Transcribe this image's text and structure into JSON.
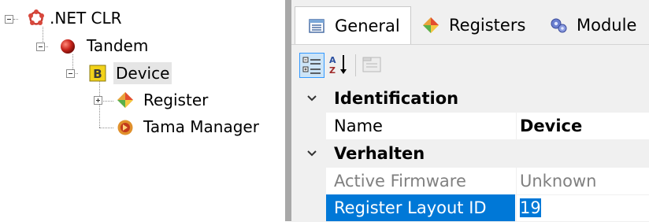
{
  "tree": {
    "nodes": [
      {
        "label": ".NET CLR",
        "icon": "dotnet-ring-icon"
      },
      {
        "label": "Tandem",
        "icon": "red-ball-icon"
      },
      {
        "label": "Device",
        "icon": "device-b-icon"
      },
      {
        "label": "Register",
        "icon": "register-diamond-icon"
      },
      {
        "label": "Tama Manager",
        "icon": "tama-manager-icon"
      }
    ]
  },
  "property_grid": {
    "tabs": [
      {
        "label": "General",
        "icon": "grid-list-icon",
        "active": true
      },
      {
        "label": "Registers",
        "icon": "register-diamond-icon",
        "active": false
      },
      {
        "label": "Module",
        "icon": "gears-icon",
        "active": false
      }
    ],
    "toolbar": {
      "categorized": "categorized-icon",
      "alphabetical": "sort-az-icon",
      "property_pages": "property-pages-icon"
    },
    "categories": [
      {
        "name": "Identification",
        "expanded": true,
        "properties": [
          {
            "name": "Name",
            "value": "Device"
          }
        ]
      },
      {
        "name": "Verhalten",
        "expanded": true,
        "properties": [
          {
            "name": "Active Firmware",
            "value": "Unknown"
          },
          {
            "name": "Register Layout ID",
            "value": "19"
          }
        ]
      }
    ]
  },
  "colors": {
    "selection": "#0078d7",
    "panel_bg": "#f0f0f0",
    "readonly_text": "#808080"
  }
}
